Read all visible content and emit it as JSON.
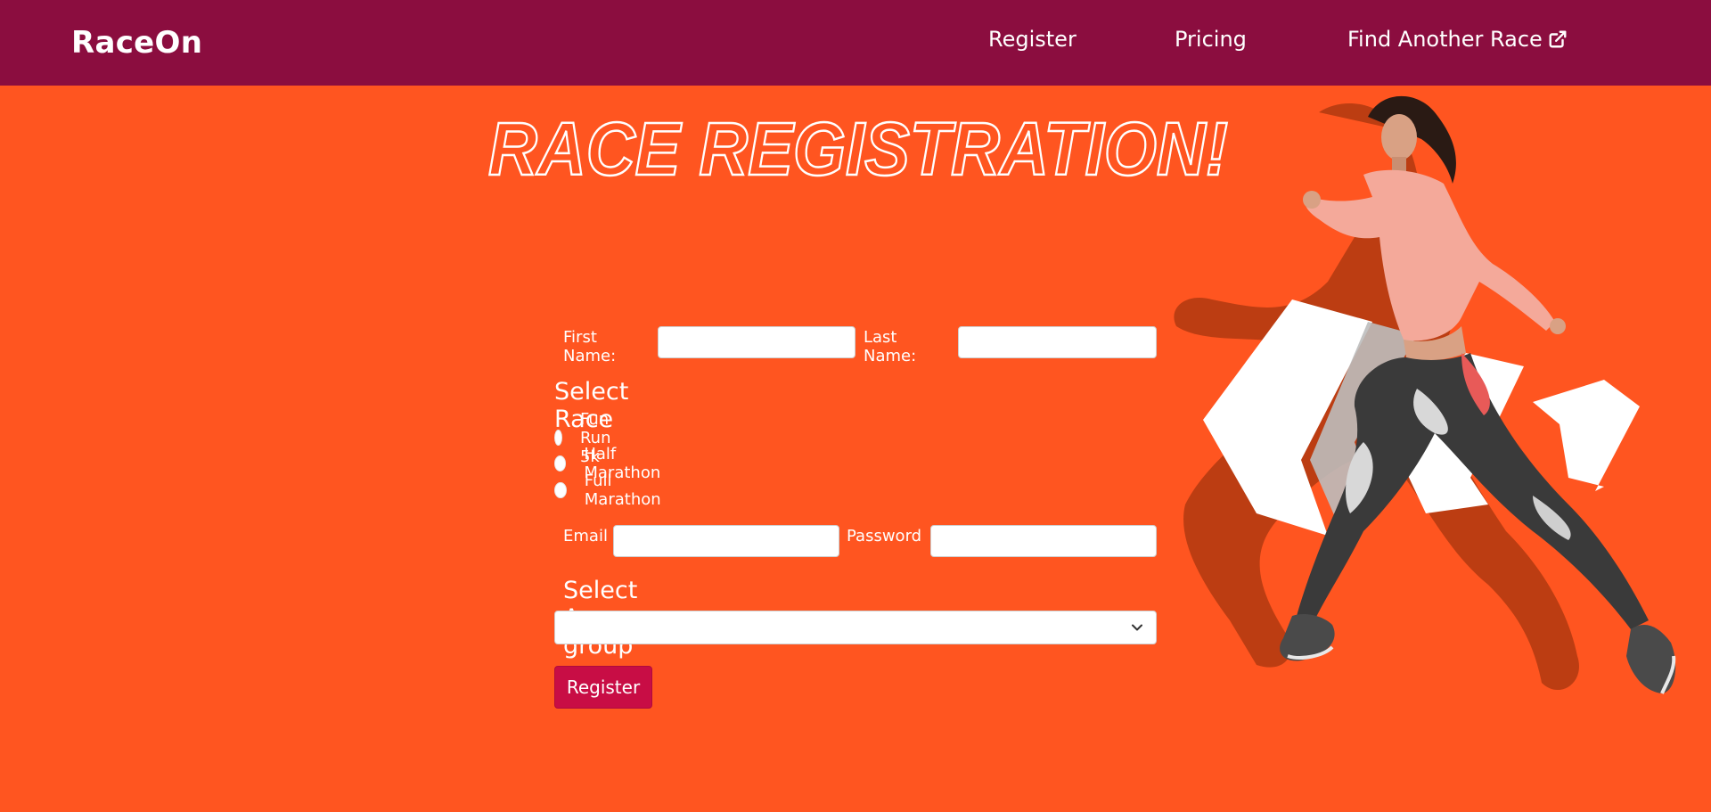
{
  "navbar": {
    "brand": "RaceOn",
    "links": {
      "register": "Register",
      "pricing": "Pricing",
      "find_another_race": "Find Another Race"
    },
    "external_icon": "external-link-icon"
  },
  "hero": {
    "title": "RACE REGISTRATION!"
  },
  "form": {
    "first_name_label": "First Name:",
    "first_name_value": "",
    "last_name_label": "Last Name:",
    "last_name_value": "",
    "select_race_heading": "Select Race",
    "race_options": [
      "Fun Run 5k",
      "Half Marathon",
      "Full Marathon"
    ],
    "selected_race": null,
    "email_label": "Email",
    "email_value": "",
    "password_label": "Password",
    "password_value": "",
    "age_group_heading": "Select Age group",
    "age_group_selected": "",
    "submit_label": "Register"
  },
  "colors": {
    "navbar_bg": "#8b0d3f",
    "page_bg": "#ff5520",
    "button_bg": "#c80d45"
  }
}
